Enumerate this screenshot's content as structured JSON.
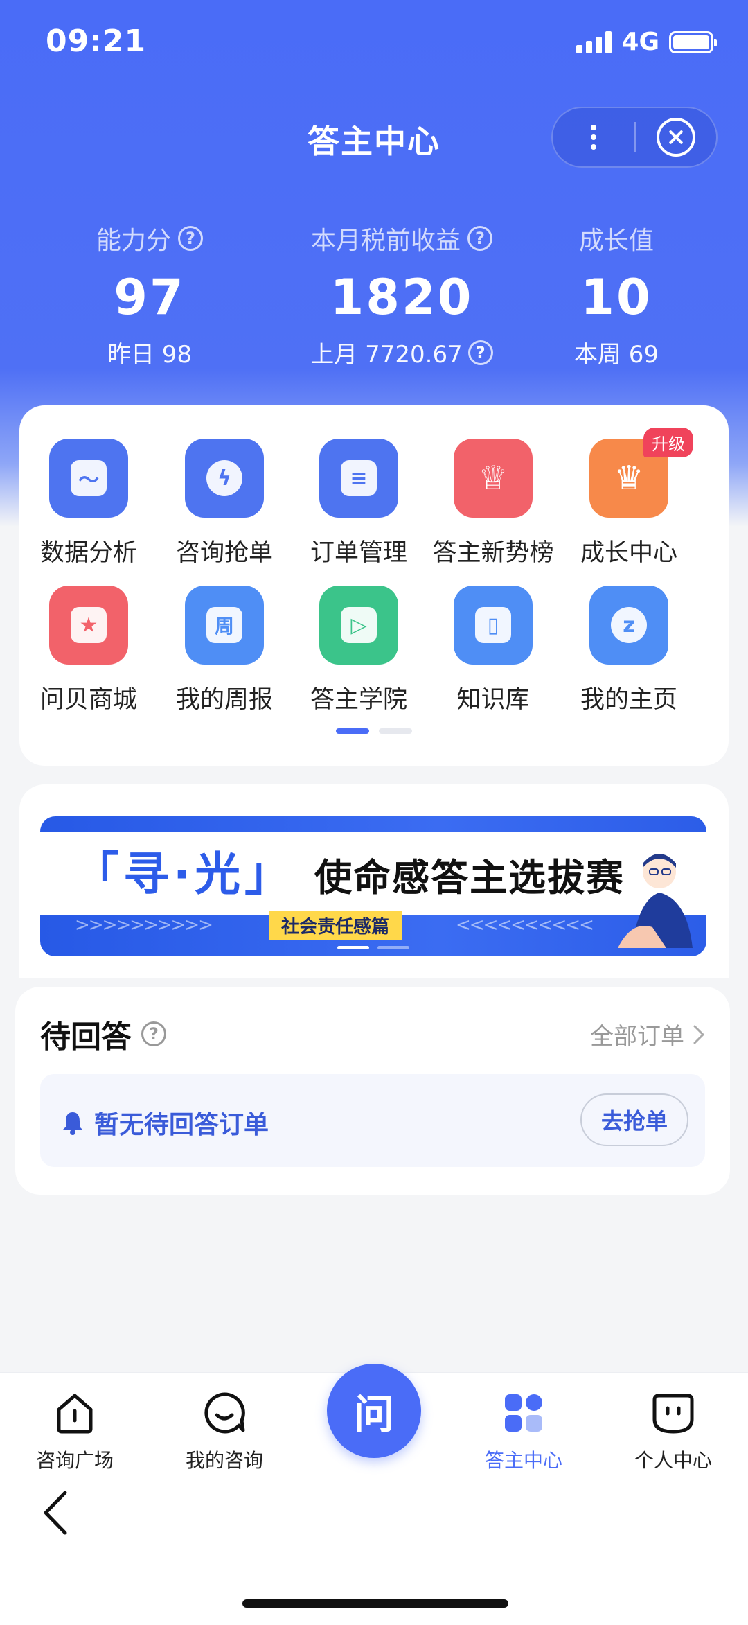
{
  "status_bar": {
    "time": "09:21",
    "network": "4G"
  },
  "header": {
    "title": "答主中心"
  },
  "stats": [
    {
      "label": "能力分",
      "value": "97",
      "sub": "昨日 98",
      "help": true
    },
    {
      "label": "本月税前收益",
      "value": "1820",
      "sub": "上月 7720.67",
      "help": true
    },
    {
      "label": "成长值",
      "value": "10",
      "sub": "本周 69",
      "help": false
    }
  ],
  "menu": {
    "items": [
      {
        "label": "数据分析",
        "icon": "chart-icon",
        "color": "#4e74f0",
        "glyph": "〜"
      },
      {
        "label": "咨询抢单",
        "icon": "lightning-icon",
        "color": "#4e74f0",
        "glyph": "ϟ"
      },
      {
        "label": "订单管理",
        "icon": "document-icon",
        "color": "#4e74f0",
        "glyph": "≡"
      },
      {
        "label": "答主新势榜",
        "icon": "trophy-icon",
        "color": "#f2626a",
        "glyph": "♕"
      },
      {
        "label": "成长中心",
        "icon": "crown-icon",
        "color": "#f7894a",
        "glyph": "♛",
        "badge": "升级"
      },
      {
        "label": "问贝商城",
        "icon": "shop-icon",
        "color": "#f2626a",
        "glyph": "★"
      },
      {
        "label": "我的周报",
        "icon": "calendar-icon",
        "color": "#4f8ef5",
        "glyph": "周"
      },
      {
        "label": "答主学院",
        "icon": "play-icon",
        "color": "#3bc48a",
        "glyph": "▷"
      },
      {
        "label": "知识库",
        "icon": "book-icon",
        "color": "#4f8ef5",
        "glyph": "▯"
      },
      {
        "label": "我的主页",
        "icon": "star-icon",
        "color": "#4f8ef5",
        "glyph": "z"
      }
    ]
  },
  "banner": {
    "title_left": "「寻·光」",
    "title_right": "使命感答主选拔赛",
    "tag": "社会责任感篇"
  },
  "pending": {
    "title": "待回答",
    "all_orders": "全部订单",
    "empty_text": "暂无待回答订单",
    "grab_button": "去抢单"
  },
  "tabbar": {
    "tabs": [
      {
        "label": "咨询广场",
        "icon": "home-icon"
      },
      {
        "label": "我的咨询",
        "icon": "chat-icon"
      },
      {
        "label": "答主中心",
        "icon": "apps-icon",
        "active": true
      },
      {
        "label": "个人中心",
        "icon": "face-icon"
      }
    ],
    "center_glyph": "问"
  }
}
